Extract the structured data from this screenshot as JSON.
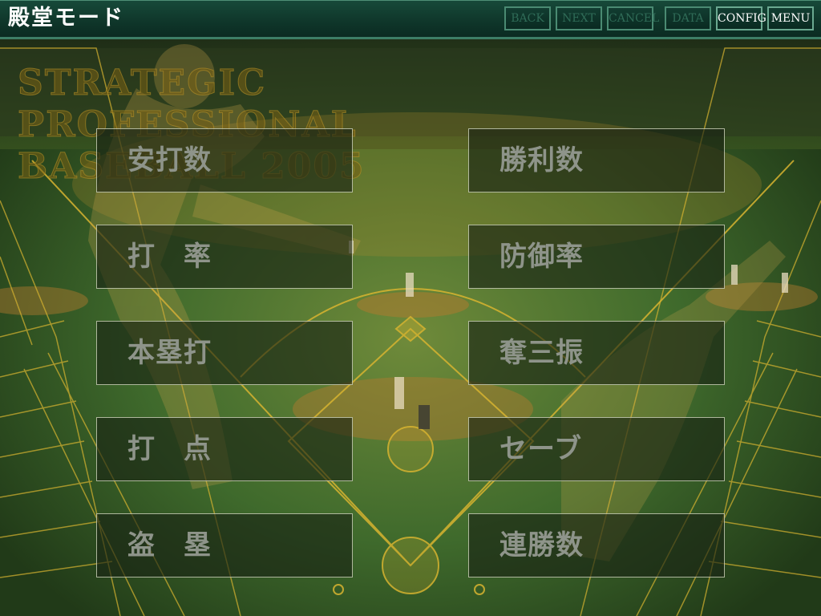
{
  "header": {
    "title": "殿堂モード",
    "buttons": [
      {
        "label": "BACK",
        "enabled": false
      },
      {
        "label": "NEXT",
        "enabled": false
      },
      {
        "label": "CANCEL",
        "enabled": false
      },
      {
        "label": "DATA",
        "enabled": false
      },
      {
        "label": "CONFIG",
        "enabled": true
      },
      {
        "label": "MENU",
        "enabled": true
      }
    ]
  },
  "background": {
    "watermark_lines": [
      "STRATEGIC",
      "PROFESSIONAL",
      "BASEBALL 2005"
    ]
  },
  "menu": {
    "left": [
      {
        "label": "安打数"
      },
      {
        "label": "打　率"
      },
      {
        "label": "本塁打"
      },
      {
        "label": "打　点"
      },
      {
        "label": "盗　塁"
      }
    ],
    "right": [
      {
        "label": "勝利数"
      },
      {
        "label": "防御率"
      },
      {
        "label": "奪三振"
      },
      {
        "label": "セーブ"
      },
      {
        "label": "連勝数"
      }
    ]
  },
  "colors": {
    "titlebar": "#0f362a",
    "button_border": "#4a8a72",
    "menu_text": "#8e948a",
    "field_green": "#3f6a2c",
    "field_line": "#d8b430"
  }
}
